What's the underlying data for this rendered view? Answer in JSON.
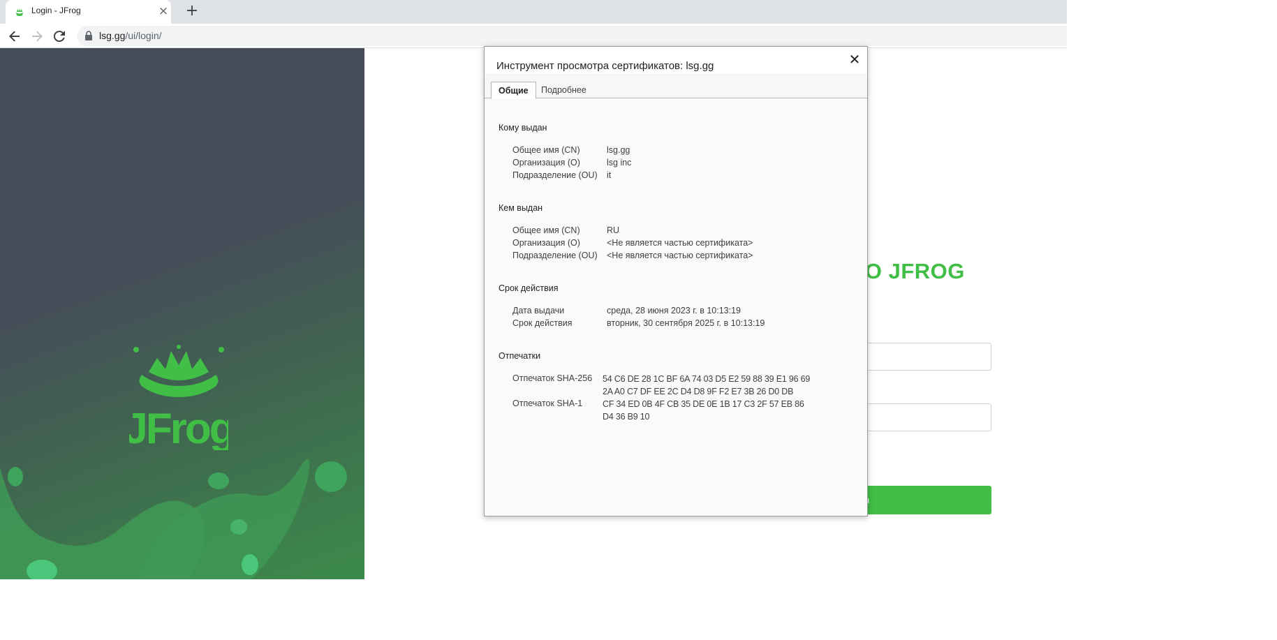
{
  "browser": {
    "tab_title": "Login - JFrog",
    "url_host": "lsg.gg",
    "url_path": "/ui/login/"
  },
  "page": {
    "logo_text": "JFrog",
    "login_title_visible": "TO JFROG",
    "login_button_visible": "n"
  },
  "dialog": {
    "title": "Инструмент просмотра сертификатов: lsg.gg",
    "tabs": [
      "Общие",
      "Подробнее"
    ],
    "issued_to": {
      "heading": "Кому выдан",
      "rows": [
        {
          "key": "Общее имя (CN)",
          "value": "lsg.gg"
        },
        {
          "key": "Организация (O)",
          "value": "lsg inc"
        },
        {
          "key": "Подразделение (OU)",
          "value": "it"
        }
      ]
    },
    "issued_by": {
      "heading": "Кем выдан",
      "rows": [
        {
          "key": "Общее имя (CN)",
          "value": "RU"
        },
        {
          "key": "Организация (O)",
          "value": "<Не является частью сертификата>"
        },
        {
          "key": "Подразделение (OU)",
          "value": "<Не является частью сертификата>"
        }
      ]
    },
    "validity": {
      "heading": "Срок действия",
      "rows": [
        {
          "key": "Дата выдачи",
          "value": "среда, 28 июня 2023 г. в 10:13:19"
        },
        {
          "key": "Срок действия",
          "value": "вторник, 30 сентября 2025 г. в 10:13:19"
        }
      ]
    },
    "fingerprints": {
      "heading": "Отпечатки",
      "rows": [
        {
          "key": "Отпечаток SHA-256",
          "value": "54 C6 DE 28 1C BF 6A 74 03 D5 E2 59 88 39 E1 96 69 2A A0 C7 DF EE 2C D4 D8 9F F2 E7 3B 26 D0 DB"
        },
        {
          "key": "Отпечаток SHA-1",
          "value": "CF 34 ED 0B 4F CB 35 DE 0E 1B 17 C3 2F 57 EB 86 D4 36 B9 10"
        }
      ]
    }
  },
  "colors": {
    "jfrog_green": "#40be46",
    "panel_top": "#474c5b",
    "panel_bottom": "#3b8b4a"
  }
}
